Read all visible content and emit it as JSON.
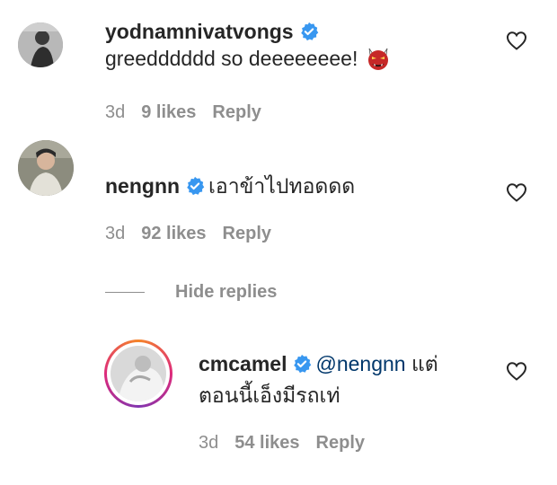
{
  "comments": [
    {
      "username": "yodnamnivatvongs",
      "text": "greedddddd so deeeeeeee!",
      "emoji_icon": "ogre-mask-icon",
      "time": "3d",
      "likes": "9 likes",
      "reply": "Reply"
    },
    {
      "username": "nengnn",
      "text": "เอาข้าไปทอดดด",
      "time": "3d",
      "likes": "92 likes",
      "reply": "Reply"
    }
  ],
  "hide_replies": "Hide replies",
  "reply_comment": {
    "username": "cmcamel",
    "mention": "@nengnn",
    "text_line1": " แต่",
    "text_line2": "ตอนนี้เอ็งมีรถเท่",
    "time": "3d",
    "likes": "54 likes",
    "reply": "Reply"
  },
  "colors": {
    "verified": "#3897f0",
    "mention": "#00376b",
    "meta": "#8e8e8e",
    "story_ring": [
      "#f58529",
      "#dd2a7b",
      "#8134af"
    ]
  }
}
